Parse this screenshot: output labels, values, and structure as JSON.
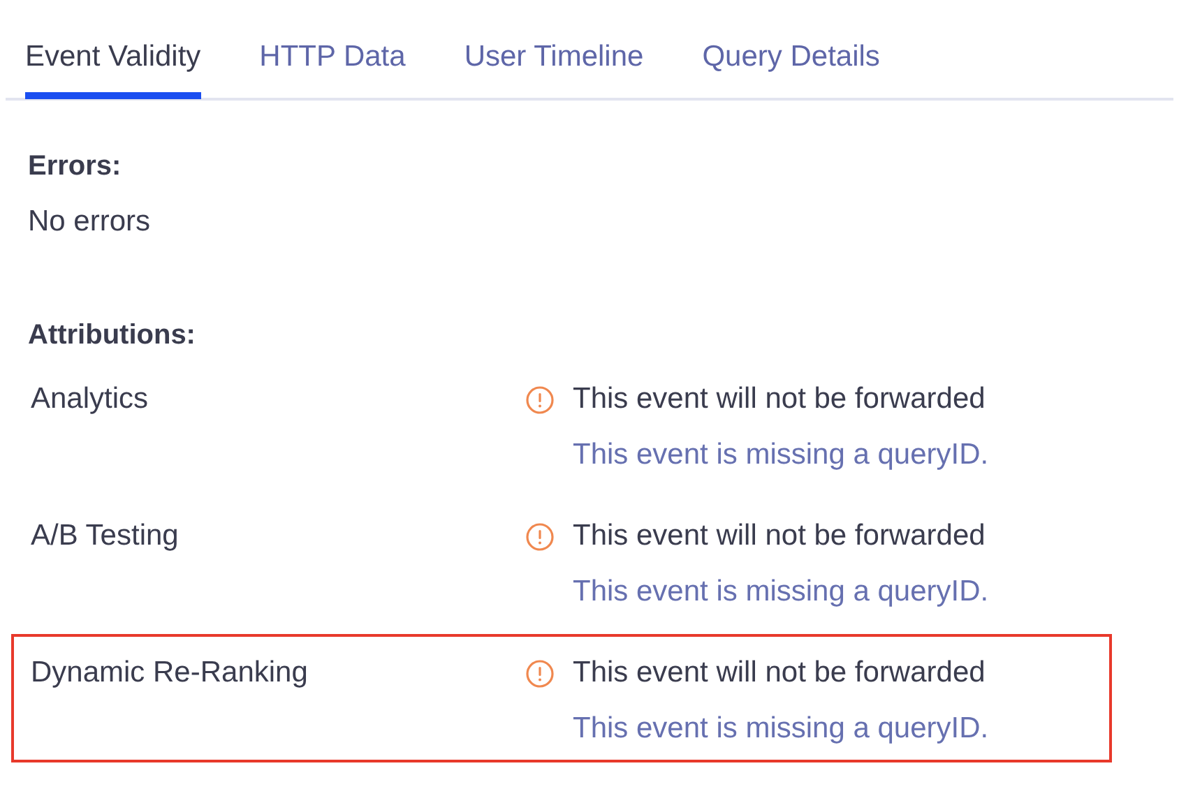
{
  "tabs": [
    {
      "label": "Event Validity",
      "selected": true
    },
    {
      "label": "HTTP Data",
      "selected": false
    },
    {
      "label": "User Timeline",
      "selected": false
    },
    {
      "label": "Query Details",
      "selected": false
    }
  ],
  "errors": {
    "heading": "Errors:",
    "text": "No errors"
  },
  "attributions": {
    "heading": "Attributions:",
    "items": [
      {
        "name": "Analytics",
        "status": "This event will not be forwarded",
        "reason": "This event is missing a queryID.",
        "highlighted": false
      },
      {
        "name": "A/B Testing",
        "status": "This event will not be forwarded",
        "reason": "This event is missing a queryID.",
        "highlighted": false
      },
      {
        "name": "Dynamic Re-Ranking",
        "status": "This event will not be forwarded",
        "reason": "This event is missing a queryID.",
        "highlighted": true
      }
    ]
  }
}
